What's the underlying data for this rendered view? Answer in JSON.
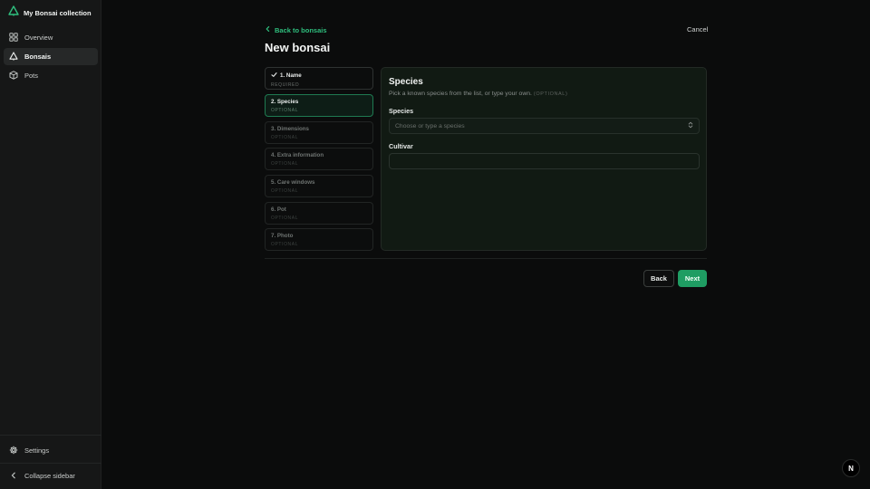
{
  "brand": {
    "name": "My Bonsai collection",
    "icon": "tree-logo-icon",
    "accent": "#2fbf7e"
  },
  "sidebar": {
    "items": [
      {
        "label": "Overview",
        "icon": "grid-icon",
        "active": false
      },
      {
        "label": "Bonsais",
        "icon": "tree-icon",
        "active": true
      },
      {
        "label": "Pots",
        "icon": "box-icon",
        "active": false
      }
    ],
    "settings_label": "Settings",
    "collapse_label": "Collapse sidebar"
  },
  "header": {
    "back_label": "Back to bonsais",
    "cancel_label": "Cancel",
    "title": "New bonsai"
  },
  "steps": [
    {
      "title": "1. Name",
      "sub": "REQUIRED",
      "state": "done"
    },
    {
      "title": "2. Species",
      "sub": "OPTIONAL",
      "state": "active"
    },
    {
      "title": "3. Dimensions",
      "sub": "OPTIONAL",
      "state": "pending"
    },
    {
      "title": "4. Extra information",
      "sub": "OPTIONAL",
      "state": "pending"
    },
    {
      "title": "5. Care windows",
      "sub": "OPTIONAL",
      "state": "pending"
    },
    {
      "title": "6. Pot",
      "sub": "OPTIONAL",
      "state": "pending"
    },
    {
      "title": "7. Photo",
      "sub": "OPTIONAL",
      "state": "pending"
    }
  ],
  "panel": {
    "title": "Species",
    "description": "Pick a known species from the list, or type your own.",
    "optional_tag": "(OPTIONAL)",
    "species_label": "Species",
    "species_placeholder": "Choose or type a species",
    "cultivar_label": "Cultivar",
    "cultivar_value": ""
  },
  "footer": {
    "back_label": "Back",
    "next_label": "Next"
  },
  "badge": {
    "label": "N"
  },
  "colors": {
    "accent": "#1f9d63",
    "link": "#2fbf7e",
    "panel_bg": "#111a13"
  }
}
